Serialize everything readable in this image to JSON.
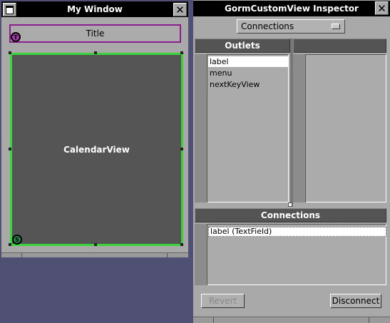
{
  "my_window": {
    "title": "My Window",
    "close_glyph": "✕",
    "title_field_text": "Title",
    "title_badge": "T",
    "custom_view_label": "CalendarView",
    "view_badge": "S",
    "selection_color": "#3cd23c",
    "connection_color": "#8d1d8d"
  },
  "inspector": {
    "title": "GormCustomView Inspector",
    "close_glyph": "✕",
    "mode_popup": "Connections",
    "outlets_header": "Outlets",
    "outlets": [
      "label",
      "menu",
      "nextKeyView"
    ],
    "selected_outlet_index": 0,
    "connections_header": "Connections",
    "connections": [
      "label (TextField)"
    ],
    "revert_label": "Revert",
    "revert_enabled": false,
    "disconnect_label": "Disconnect"
  },
  "icons": {
    "miniaturize": "miniaturize-icon",
    "close": "close-icon",
    "popup_arrow": "popup-arrow-icon"
  }
}
